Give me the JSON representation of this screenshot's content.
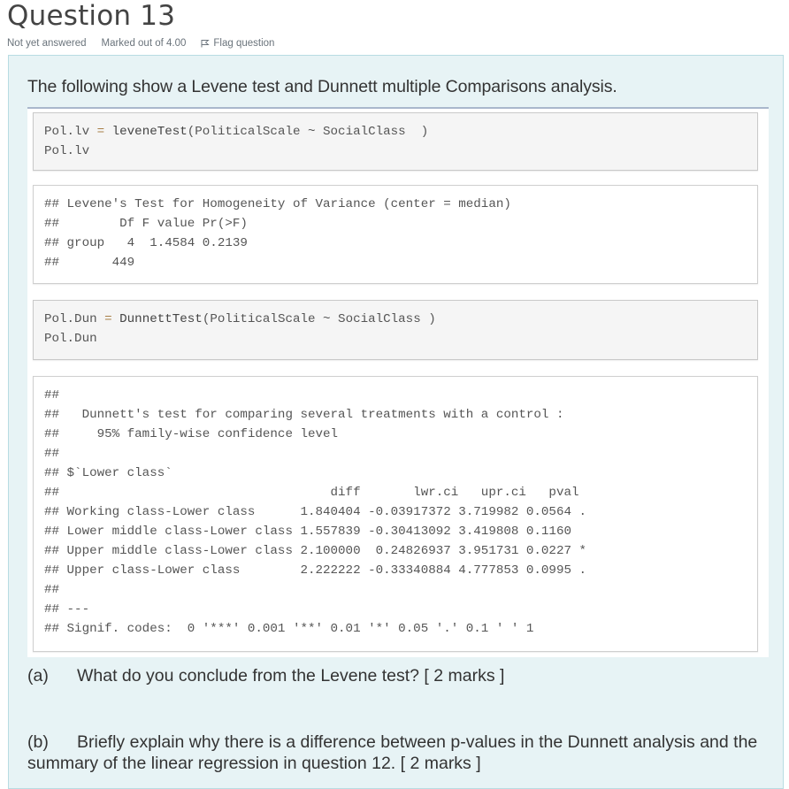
{
  "question": {
    "title": "Question 13",
    "status": "Not yet answered",
    "marks": "Marked out of 4.00",
    "flag_label": "Flag question",
    "flag_icon": "flag-icon"
  },
  "content": {
    "intro": "The following show a Levene test and Dunnett multiple Comparisons analysis.",
    "levene_code": [
      {
        "lhs": "Pol.lv",
        "op": "=",
        "fn": "leveneTest",
        "args": "(PoliticalScale ~ SocialClass  )"
      },
      {
        "text": "Pol.lv"
      }
    ],
    "levene_output": [
      "## Levene's Test for Homogeneity of Variance (center = median)",
      "##        Df F value Pr(>F)",
      "## group   4  1.4584 0.2139",
      "##       449"
    ],
    "dunnett_code": [
      {
        "lhs": "Pol.Dun",
        "op": "=",
        "fn": "DunnettTest",
        "args": "(PoliticalScale ~ SocialClass )"
      },
      {
        "text": "Pol.Dun"
      }
    ],
    "dunnett_output": [
      "##",
      "##   Dunnett's test for comparing several treatments with a control :",
      "##     95% family-wise confidence level",
      "##",
      "## $`Lower class`",
      "##                                    diff       lwr.ci   upr.ci   pval",
      "## Working class-Lower class      1.840404 -0.03917372 3.719982 0.0564 .",
      "## Lower middle class-Lower class 1.557839 -0.30413092 3.419808 0.1160",
      "## Upper middle class-Lower class 2.100000  0.24826937 3.951731 0.0227 *",
      "## Upper class-Lower class        2.222222 -0.33340884 4.777853 0.0995 .",
      "##",
      "## ---",
      "## Signif. codes:  0 '***' 0.001 '**' 0.01 '*' 0.05 '.' 0.1 ' ' 1"
    ],
    "dunnett_table": {
      "columns": [
        "diff",
        "lwr.ci",
        "upr.ci",
        "pval"
      ],
      "rows": [
        {
          "comparison": "Working class-Lower class",
          "diff": "1.840404",
          "lwr.ci": "-0.03917372",
          "upr.ci": "3.719982",
          "pval": "0.0564",
          "signif": "."
        },
        {
          "comparison": "Lower middle class-Lower class",
          "diff": "1.557839",
          "lwr.ci": "-0.30413092",
          "upr.ci": "3.419808",
          "pval": "0.1160",
          "signif": ""
        },
        {
          "comparison": "Upper middle class-Lower class",
          "diff": "2.100000",
          "lwr.ci": "0.24826937",
          "upr.ci": "3.951731",
          "pval": "0.0227",
          "signif": "*"
        },
        {
          "comparison": "Upper class-Lower class",
          "diff": "2.222222",
          "lwr.ci": "-0.33340884",
          "upr.ci": "4.777853",
          "pval": "0.0995",
          "signif": "."
        }
      ]
    },
    "levene_table": {
      "columns": [
        "Df",
        "F value",
        "Pr(>F)"
      ],
      "group": {
        "Df": "4",
        "F value": "1.4584",
        "Pr(>F)": "0.2139"
      },
      "residual_df": "449"
    },
    "part_a": {
      "label": "(a)",
      "text": "What do you conclude from the Levene test? [ 2 marks ]"
    },
    "part_b": {
      "label": "(b)",
      "text": "Briefly explain why there is a difference between p-values in the Dunnett analysis and the summary of the linear regression in question 12.  [ 2 marks ]"
    }
  },
  "colors": {
    "panel_bg": "#e7f3f5",
    "panel_border": "#b8dce2",
    "code_bg": "#f5f5f5",
    "operator": "#a87e47"
  }
}
